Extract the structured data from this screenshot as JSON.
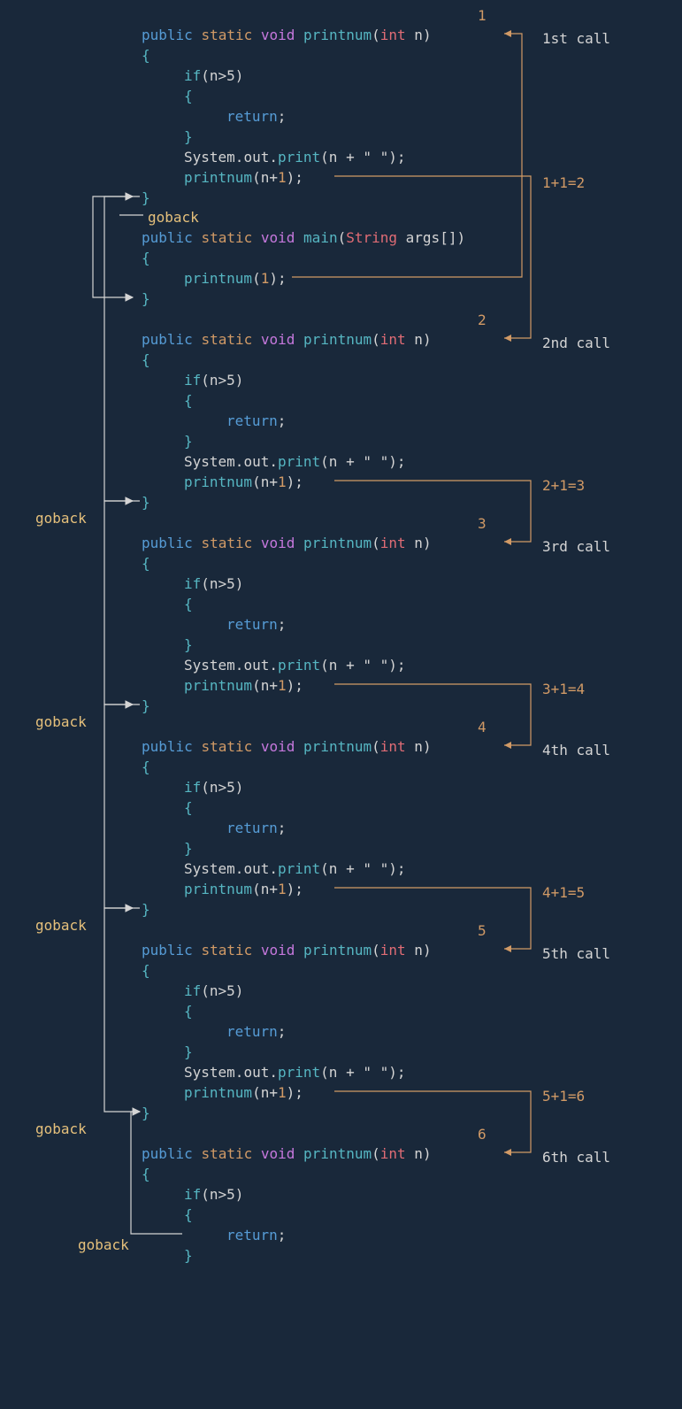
{
  "method_sig": {
    "public": "public",
    "static": "static",
    "void": "void",
    "fn": "printnum",
    "type": "int",
    "var": "n"
  },
  "main_sig": {
    "public": "public",
    "static": "static",
    "void": "void",
    "fn": "main",
    "type": "String",
    "var": "args[]"
  },
  "body": {
    "if": "if",
    "cond": "(n>5)",
    "ret": "return",
    "sysout": "System.out.print(n + \" \");",
    "recurse": "printnum(n+1);",
    "call1": "printnum(1);"
  },
  "labels": {
    "goback": "goback",
    "calls": [
      "1st call",
      "2nd call",
      "3rd call",
      "4th call",
      "5th call",
      "6th call"
    ],
    "nums": [
      "1",
      "2",
      "3",
      "4",
      "5",
      "6"
    ],
    "eqs": [
      "1+1=2",
      "2+1=3",
      "3+1=4",
      "4+1=5",
      "5+1=6"
    ]
  }
}
